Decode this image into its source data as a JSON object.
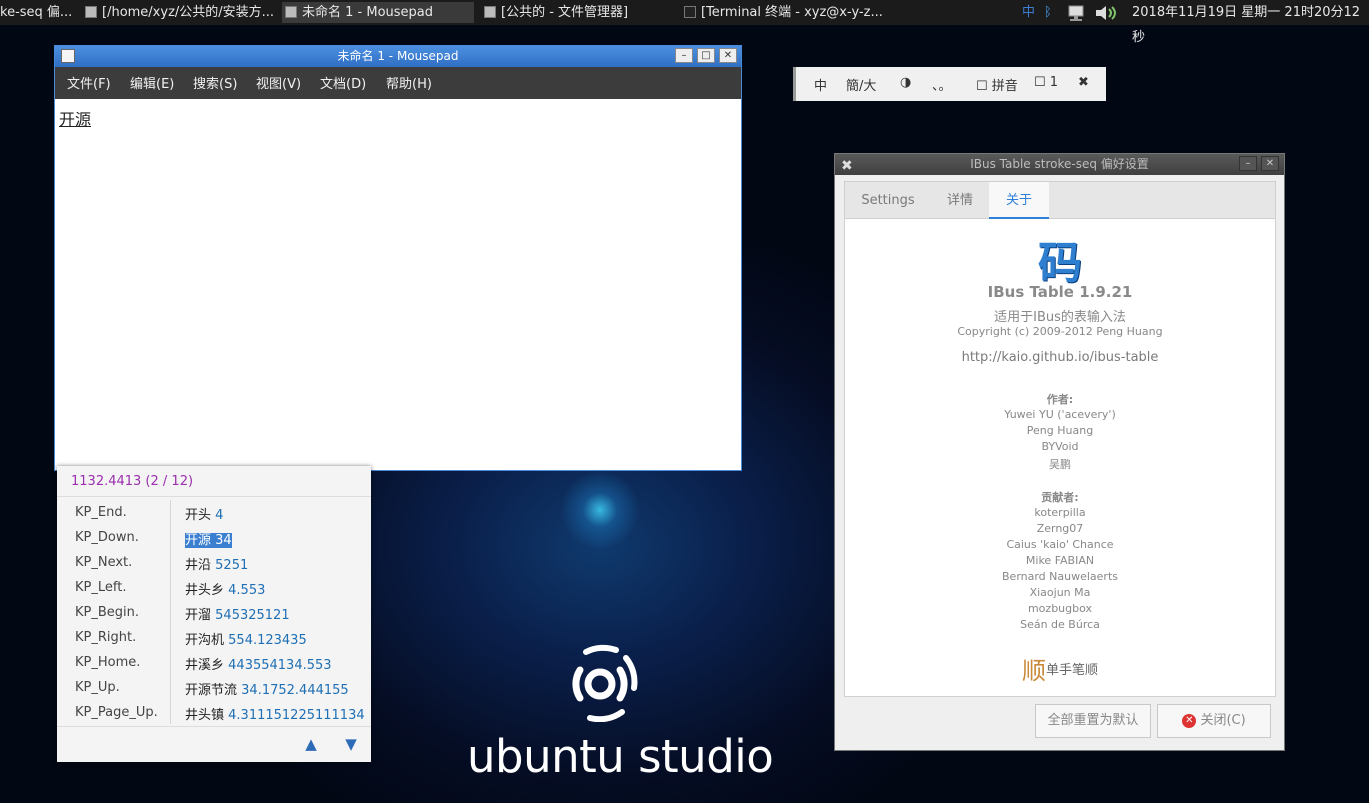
{
  "taskbar": {
    "tasks": [
      {
        "label": "ke-seq 偏..."
      },
      {
        "label": "[/home/xyz/公共的/安装方..."
      },
      {
        "label": "未命名 1 - Mousepad"
      },
      {
        "label": "[公共的 - 文件管理器]"
      },
      {
        "label": "[Terminal 终端 - xyz@x-y-z..."
      }
    ],
    "ime_indicator": "中",
    "clock": "2018年11月19日 星期一 21时20分12秒"
  },
  "mousepad": {
    "title": "未命名 1 - Mousepad",
    "menu": [
      "文件(F)",
      "编辑(E)",
      "搜索(S)",
      "视图(V)",
      "文档(D)",
      "帮助(H)"
    ],
    "content": "开源"
  },
  "ime_toolbar": {
    "lang": "中",
    "mode": "簡/大",
    "halfwidth": "◑",
    "punct": "、。",
    "pinyin": "☐ 拼音",
    "one": "☐ 1",
    "settings_icon": "tools-icon"
  },
  "candidates": {
    "header": "1132.4413 (2 / 12)",
    "rows": [
      {
        "key": "KP_End.",
        "word": "开头",
        "score": "4"
      },
      {
        "key": "KP_Down.",
        "word": "开源",
        "score": "34"
      },
      {
        "key": "KP_Next.",
        "word": "井沿",
        "score": "5251"
      },
      {
        "key": "KP_Left.",
        "word": "井头乡",
        "score": "4.553"
      },
      {
        "key": "KP_Begin.",
        "word": "开溜",
        "score": "545325121"
      },
      {
        "key": "KP_Right.",
        "word": "开沟机",
        "score": "554.123435"
      },
      {
        "key": "KP_Home.",
        "word": "井溪乡",
        "score": "443554134.553"
      },
      {
        "key": "KP_Up.",
        "word": "开源节流",
        "score": "34.1752.444155"
      },
      {
        "key": "KP_Page_Up.",
        "word": "井头镇",
        "score": "4.311151225111134"
      }
    ]
  },
  "desktop": {
    "brand": "ubuntu studio"
  },
  "prefs": {
    "title": "IBus Table stroke-seq 偏好设置",
    "tabs": [
      "Settings",
      "详情",
      "关于"
    ],
    "about": {
      "glyph": "码",
      "name": "IBus Table 1.9.21",
      "desc": "适用于IBus的表输入法",
      "copyright": "Copyright (c) 2009-2012 Peng Huang",
      "url": "http://kaio.github.io/ibus-table",
      "authors_label": "作者:",
      "authors": [
        "Yuwei YU ('acevery')",
        "Peng Huang",
        "BYVoid",
        "吴鹏"
      ],
      "contributors_label": "贡献者:",
      "contributors": [
        "koterpilla",
        "Zerng07",
        "Caius 'kaio' Chance",
        "Mike FABIAN",
        "Bernard Nauwelaerts",
        "Xiaojun Ma",
        "mozbugbox",
        "Seán de Búrca"
      ],
      "table_logo_glyph": "顺",
      "table_name": "单手笔顺"
    },
    "buttons": {
      "reset": "全部重置为默认",
      "close": "关闭(C)"
    }
  },
  "colors": {
    "accent": "#2f80d8",
    "candidate_header": "#9b2fae",
    "score": "#1f6fb5"
  }
}
